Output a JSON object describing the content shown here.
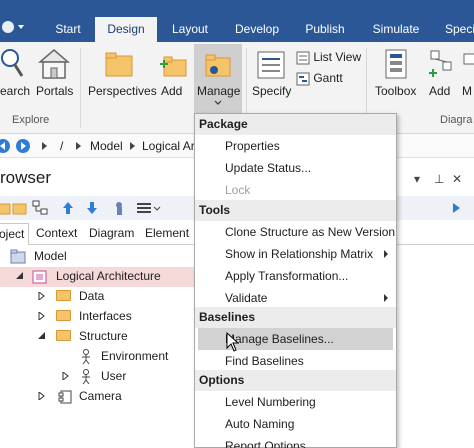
{
  "ribbon": {
    "tabs": [
      "Start",
      "Design",
      "Layout",
      "Develop",
      "Publish",
      "Simulate",
      "Speci"
    ],
    "active_tab": "Design",
    "buttons": {
      "search": "earch",
      "portals": "Portals",
      "perspectives": "Perspectives",
      "add": "Add",
      "manage": "Manage",
      "specify": "Specify",
      "list_view": "List View",
      "gantt": "Gantt",
      "toolbox": "Toolbox",
      "add2": "Add",
      "m": "M"
    },
    "groups": {
      "explore": "Explore",
      "diagram": "Diagra"
    }
  },
  "breadcrumb": {
    "sep1": "/",
    "item1": "Model",
    "item2": "Logical Arc"
  },
  "browser": {
    "title": "rowser",
    "subtabs": [
      "oject",
      "Context",
      "Diagram",
      "Element"
    ],
    "tree": {
      "model": "Model",
      "logical": "Logical Architecture",
      "data": "Data",
      "interfaces": "Interfaces",
      "structure": "Structure",
      "environment": "Environment",
      "user": "User",
      "camera": "Camera"
    }
  },
  "menu": {
    "package_header": "Package",
    "properties": "Properties",
    "update_status": "Update Status...",
    "lock": "Lock",
    "tools_header": "Tools",
    "clone": "Clone Structure as New Version",
    "show_matrix": "Show in Relationship Matrix",
    "apply_transform": "Apply Transformation...",
    "validate": "Validate",
    "baselines_header": "Baselines",
    "manage_baselines": "Manage Baselines...",
    "find_baselines": "Find Baselines",
    "options_header": "Options",
    "level_numbering": "Level Numbering",
    "auto_naming": "Auto Naming",
    "report_options": "Report Options..."
  },
  "colors": {
    "ribbon_blue": "#2b5797",
    "selection_pink": "#f6dada",
    "menu_hover": "#d2d2d2"
  }
}
